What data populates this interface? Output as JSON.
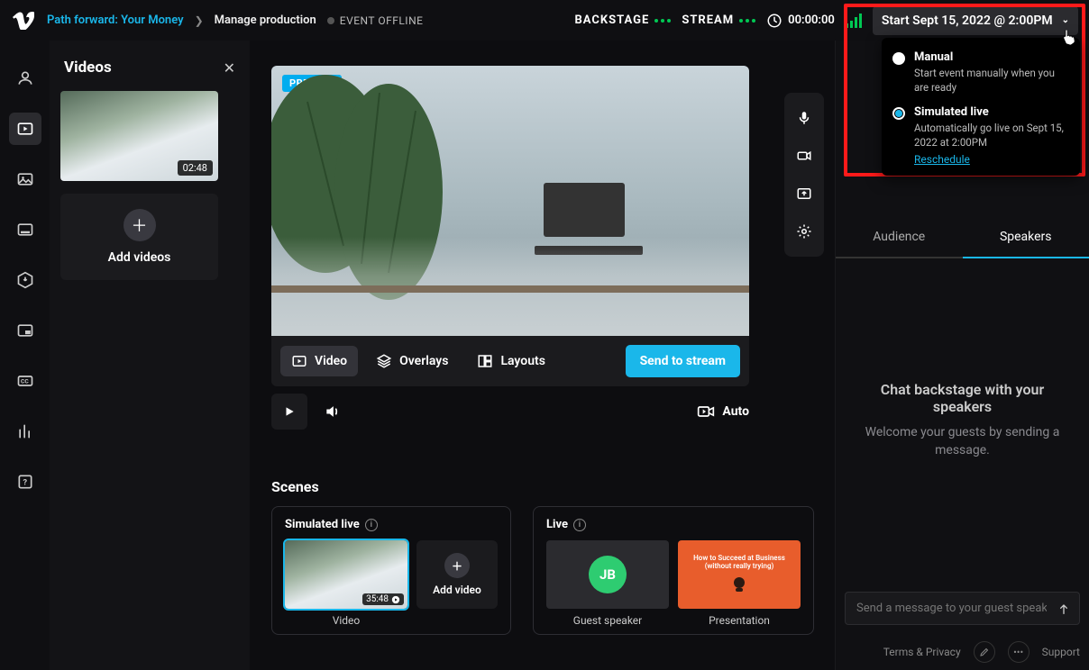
{
  "breadcrumb": {
    "project": "Path forward: Your Money",
    "page": "Manage production",
    "status": "EVENT OFFLINE"
  },
  "header": {
    "backstage": "BACKSTAGE",
    "stream": "STREAM",
    "time": "00:00:00",
    "start_button": "Start Sept 15, 2022 @ 2:00PM"
  },
  "dropdown": {
    "manual_title": "Manual",
    "manual_desc": "Start event manually when you are ready",
    "sim_title": "Simulated live",
    "sim_desc": "Automatically go live on Sept 15, 2022 at 2:00PM",
    "reschedule": "Reschedule"
  },
  "videos_panel": {
    "title": "Videos",
    "thumb_duration": "02:48",
    "add_label": "Add videos"
  },
  "toolbar": {
    "video": "Video",
    "overlays": "Overlays",
    "layouts": "Layouts",
    "send": "Send to stream",
    "auto": "Auto",
    "preview_badge": "PREVIEW"
  },
  "scenes": {
    "title": "Scenes",
    "simlive": "Simulated live",
    "live": "Live",
    "video_label": "Video",
    "video_dur": "35:48",
    "add_video": "Add video",
    "guest_initials": "JB",
    "guest_label": "Guest speaker",
    "pres_text1": "How to Succeed at Business",
    "pres_text2": "(without really trying)",
    "presentation_label": "Presentation",
    "add_label_partial": "Ad"
  },
  "chat": {
    "tab_audience": "Audience",
    "tab_speakers": "Speakers",
    "heading": "Chat backstage with your speakers",
    "sub": "Welcome your guests by sending a message.",
    "placeholder": "Send a message to your guest speakers"
  },
  "footer": {
    "terms": "Terms & Privacy",
    "support": "Support"
  }
}
